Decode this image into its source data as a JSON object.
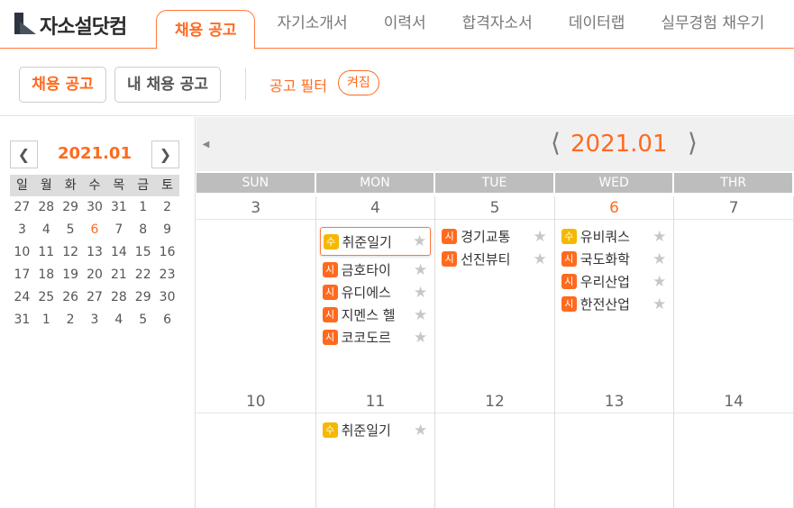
{
  "app": {
    "name": "자소설닷컴"
  },
  "tabs": [
    {
      "label": "채용 공고",
      "active": true
    },
    {
      "label": "자기소개서"
    },
    {
      "label": "이력서"
    },
    {
      "label": "합격자소서"
    },
    {
      "label": "데이터랩"
    },
    {
      "label": "실무경험 채우기"
    }
  ],
  "toolbar": {
    "primary_button": "채용 공고",
    "secondary_button": "내 채용 공고",
    "filter_label": "공고 필터",
    "filter_state": "켜짐"
  },
  "mini_calendar": {
    "title": "2021.01",
    "weekdays": [
      "일",
      "월",
      "화",
      "수",
      "목",
      "금",
      "토"
    ],
    "weeks": [
      [
        "27",
        "28",
        "29",
        "30",
        "31",
        "1",
        "2"
      ],
      [
        "3",
        "4",
        "5",
        "6",
        "7",
        "8",
        "9"
      ],
      [
        "10",
        "11",
        "12",
        "13",
        "14",
        "15",
        "16"
      ],
      [
        "17",
        "18",
        "19",
        "20",
        "21",
        "22",
        "23"
      ],
      [
        "24",
        "25",
        "26",
        "27",
        "28",
        "29",
        "30"
      ],
      [
        "31",
        "1",
        "2",
        "3",
        "4",
        "5",
        "6"
      ]
    ],
    "today": "6"
  },
  "calendar": {
    "title": "2021.01",
    "weekdays": [
      "SUN",
      "MON",
      "TUE",
      "WED",
      "THR"
    ],
    "weeks": [
      {
        "days": [
          {
            "num": "3",
            "events": []
          },
          {
            "num": "4",
            "events": [
              {
                "badge": "수",
                "type": "end",
                "name": "취준일기",
                "highlight": true
              },
              {
                "badge": "시",
                "type": "start",
                "name": "금호타이"
              },
              {
                "badge": "시",
                "type": "start",
                "name": "유디에스"
              },
              {
                "badge": "시",
                "type": "start",
                "name": "지멘스 헬"
              },
              {
                "badge": "시",
                "type": "start",
                "name": "코코도르"
              }
            ]
          },
          {
            "num": "5",
            "events": [
              {
                "badge": "시",
                "type": "start",
                "name": "경기교통"
              },
              {
                "badge": "시",
                "type": "start",
                "name": "선진뷰티"
              }
            ]
          },
          {
            "num": "6",
            "today": true,
            "events": [
              {
                "badge": "수",
                "type": "end",
                "name": "유비쿼스"
              },
              {
                "badge": "시",
                "type": "start",
                "name": "국도화학"
              },
              {
                "badge": "시",
                "type": "start",
                "name": "우리산업"
              },
              {
                "badge": "시",
                "type": "start",
                "name": "한전산업"
              }
            ]
          },
          {
            "num": "7",
            "events": []
          }
        ]
      },
      {
        "days": [
          {
            "num": "10",
            "events": []
          },
          {
            "num": "11",
            "events": [
              {
                "badge": "수",
                "type": "end",
                "name": "취준일기"
              }
            ]
          },
          {
            "num": "12",
            "events": []
          },
          {
            "num": "13",
            "events": []
          },
          {
            "num": "14",
            "events": []
          }
        ]
      }
    ]
  },
  "colors": {
    "accent": "#ff6a1f",
    "start_badge": "#ff6a1f",
    "end_badge": "#f5b800"
  }
}
